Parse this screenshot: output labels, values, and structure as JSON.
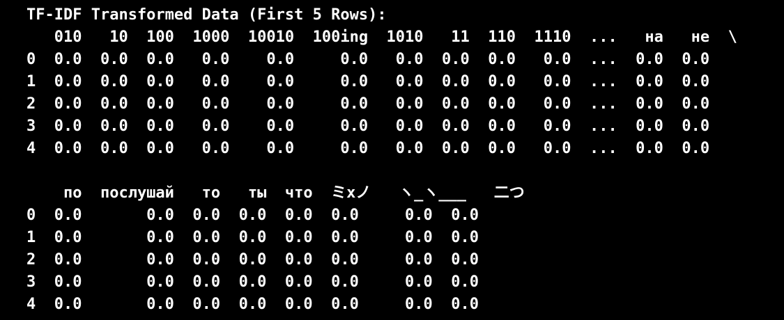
{
  "terminal": {
    "title": "TF-IDF Transformed Data (First 5 Rows):",
    "block1": {
      "header": "   010   10  100  1000  10010  100ing  1010   11  110  1110  ...   на   не  \\",
      "rows": [
        "0  0.0  0.0  0.0   0.0    0.0     0.0   0.0  0.0  0.0   0.0  ...  0.0  0.0",
        "1  0.0  0.0  0.0   0.0    0.0     0.0   0.0  0.0  0.0   0.0  ...  0.0  0.0",
        "2  0.0  0.0  0.0   0.0    0.0     0.0   0.0  0.0  0.0   0.0  ...  0.0  0.0",
        "3  0.0  0.0  0.0   0.0    0.0     0.0   0.0  0.0  0.0   0.0  ...  0.0  0.0",
        "4  0.0  0.0  0.0   0.0    0.0     0.0   0.0  0.0  0.0   0.0  ...  0.0  0.0"
      ]
    },
    "block2": {
      "header": "    по  послушай   то   ты  что  ミxノ   ヽ_ヽ___   二つ",
      "rows": [
        "0  0.0       0.0  0.0  0.0  0.0  0.0     0.0  0.0",
        "1  0.0       0.0  0.0  0.0  0.0  0.0     0.0  0.0",
        "2  0.0       0.0  0.0  0.0  0.0  0.0     0.0  0.0",
        "3  0.0       0.0  0.0  0.0  0.0  0.0     0.0  0.0",
        "4  0.0       0.0  0.0  0.0  0.0  0.0     0.0  0.0"
      ]
    }
  }
}
